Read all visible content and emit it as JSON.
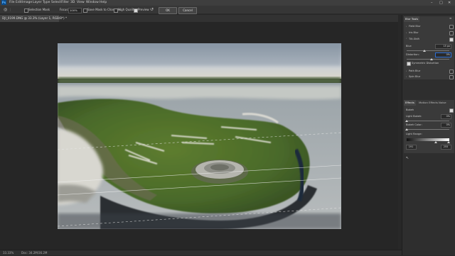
{
  "menubar": {
    "items": [
      "File",
      "Edit",
      "Image",
      "Layer",
      "Type",
      "Select",
      "Filter",
      "3D",
      "View",
      "Window",
      "Help"
    ]
  },
  "options": {
    "selection_mask_label": "Selection Mask",
    "focus_label": "Focus:",
    "focus_value": "100%",
    "save_mask_label": "Save Mask to Channels",
    "high_quality_label": "High Quality",
    "preview_label": "Preview",
    "ok_label": "OK",
    "cancel_label": "Cancel"
  },
  "document": {
    "tab_title": "DJI_0199.DNG @ 33.3% (Layer 1, RGB/8*) *"
  },
  "status": {
    "zoom": "33.33%",
    "doc_info": "Doc: 34.2M/36.2M"
  },
  "blur_tools": {
    "title": "Blur Tools",
    "items": [
      "Field Blur",
      "Iris Blur",
      "Tilt-Shift",
      "Path Blur",
      "Spin Blur"
    ],
    "blur_label": "Blur:",
    "blur_value": "15 px",
    "distortion_label": "Distortion:",
    "distortion_value": "0%",
    "symmetric_label": "Symmetric Distortion"
  },
  "effects_panel": {
    "tabs": [
      "Effects",
      "Motion Effects",
      "Noise"
    ],
    "bokeh_label": "Bokeh",
    "light_bokeh_label": "Light Bokeh:",
    "light_bokeh_value": "0%",
    "bokeh_color_label": "Bokeh Color:",
    "bokeh_color_value": "0%",
    "light_range_label": "Light Range:",
    "light_range_low": "191",
    "light_range_high": "255"
  },
  "colors": {
    "accent": "#2d6fd6",
    "panel_bg": "#3a3a3a",
    "canvas_bg": "#262626"
  }
}
